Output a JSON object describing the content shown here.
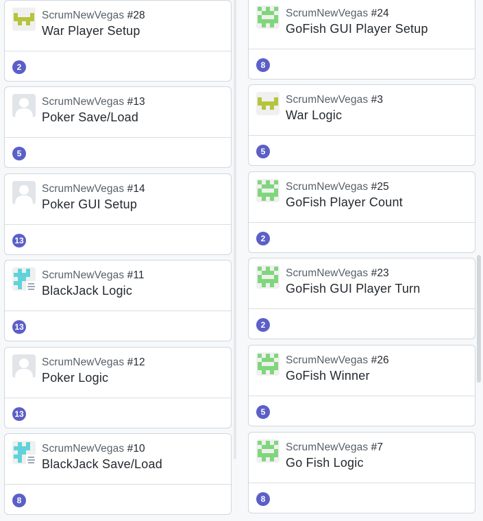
{
  "repo": "ScrumNewVegas",
  "colors": {
    "points_badge": "#5b5fc7",
    "card_border": "#d0d7de",
    "identicon_olive": "#b6c43c",
    "identicon_green": "#7fd67b",
    "identicon_teal": "#5fd3d9"
  },
  "left_column": {
    "cards": [
      {
        "repo": "ScrumNewVegas",
        "number": "#28",
        "title": "War Player Setup",
        "points": "2",
        "avatar": "identicon-olive"
      },
      {
        "repo": "ScrumNewVegas",
        "number": "#13",
        "title": "Poker Save/Load",
        "points": "5",
        "avatar": "default-user-avatar"
      },
      {
        "repo": "ScrumNewVegas",
        "number": "#14",
        "title": "Poker GUI Setup",
        "points": "13",
        "avatar": "default-user-avatar"
      },
      {
        "repo": "ScrumNewVegas",
        "number": "#11",
        "title": "BlackJack Logic",
        "points": "13",
        "avatar": "identicon-teal"
      },
      {
        "repo": "ScrumNewVegas",
        "number": "#12",
        "title": "Poker Logic",
        "points": "13",
        "avatar": "default-user-avatar"
      },
      {
        "repo": "ScrumNewVegas",
        "number": "#10",
        "title": "BlackJack Save/Load",
        "points": "8",
        "avatar": "identicon-teal"
      }
    ]
  },
  "right_column": {
    "cards": [
      {
        "repo": "ScrumNewVegas",
        "number": "#24",
        "title": "GoFish GUI Player Setup",
        "points": "8",
        "avatar": "identicon-green"
      },
      {
        "repo": "ScrumNewVegas",
        "number": "#3",
        "title": "War Logic",
        "points": "5",
        "avatar": "identicon-olive"
      },
      {
        "repo": "ScrumNewVegas",
        "number": "#25",
        "title": "GoFish Player Count",
        "points": "2",
        "avatar": "identicon-green"
      },
      {
        "repo": "ScrumNewVegas",
        "number": "#23",
        "title": "GoFish GUI Player Turn",
        "points": "2",
        "avatar": "identicon-green"
      },
      {
        "repo": "ScrumNewVegas",
        "number": "#26",
        "title": "GoFish Winner",
        "points": "5",
        "avatar": "identicon-green"
      },
      {
        "repo": "ScrumNewVegas",
        "number": "#7",
        "title": "Go Fish Logic",
        "points": "8",
        "avatar": "identicon-green"
      }
    ]
  }
}
